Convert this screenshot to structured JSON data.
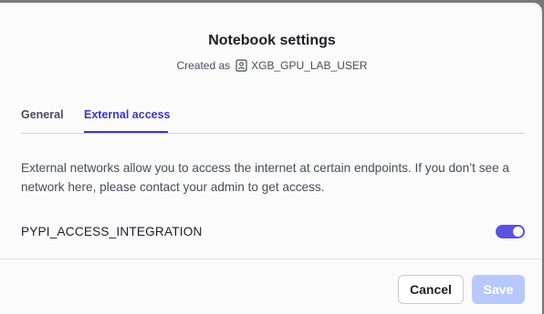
{
  "dialog": {
    "title": "Notebook settings",
    "created_as_label": "Created as",
    "role_name": "XGB_GPU_LAB_USER",
    "role_icon": "person-badge-icon"
  },
  "tabs": [
    {
      "label": "General",
      "active": false
    },
    {
      "label": "External access",
      "active": true
    }
  ],
  "external_access": {
    "description": "External networks allow you to access the internet at certain endpoints. If you don’t see a network here, please contact your admin to get access.",
    "integrations": [
      {
        "name": "PYPI_ACCESS_INTEGRATION",
        "enabled": true
      }
    ]
  },
  "footer": {
    "cancel_label": "Cancel",
    "save_label": "Save",
    "save_disabled": true
  },
  "colors": {
    "accent": "#3f35c8",
    "toggle_on": "#5a52e0",
    "save_disabled_bg": "#b7c9fb"
  }
}
